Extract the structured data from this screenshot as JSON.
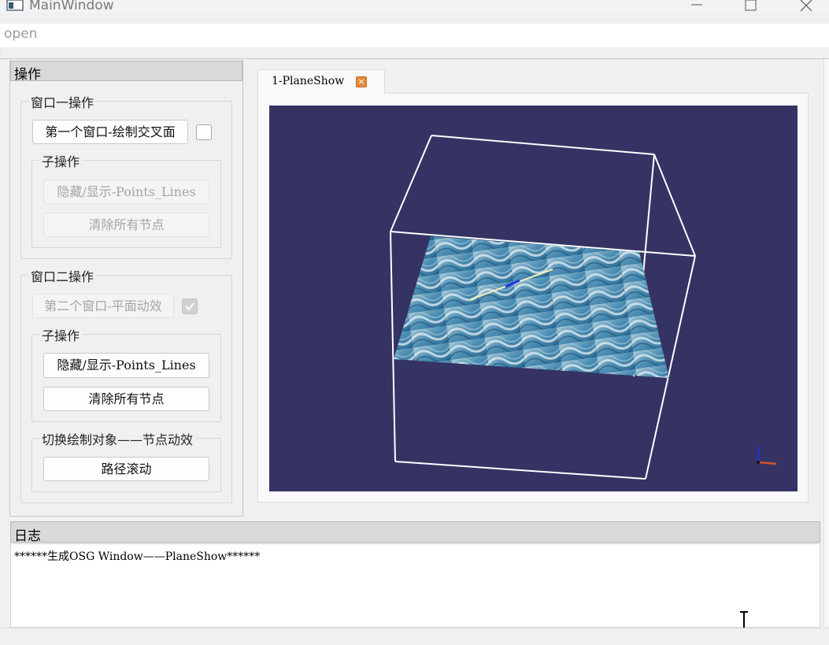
{
  "window": {
    "title": "MainWindow"
  },
  "menu": {
    "open_label": "open"
  },
  "ops_dock": {
    "title": "操作",
    "window1": {
      "group_title": "窗口一操作",
      "primary_button": "第一个窗口-绘制交叉面",
      "primary_checked": false,
      "sub_group_title": "子操作",
      "toggle_button": "隐藏/显示-Points_Lines",
      "clear_button": "清除所有节点",
      "sub_enabled": false
    },
    "window2": {
      "group_title": "窗口二操作",
      "primary_button": "第二个窗口-平面动效",
      "primary_checked": true,
      "sub_group_title": "子操作",
      "toggle_button": "隐藏/显示-Points_Lines",
      "clear_button": "清除所有节点",
      "switch_group_title": "切换绘制对象——节点动效",
      "path_button": "路径滚动"
    }
  },
  "tabs": [
    {
      "label": "1-PlaneShow",
      "active": true
    }
  ],
  "viewport": {
    "background": "#343364",
    "wireframe_color": "#ffffff",
    "plane_texture": "water-waves"
  },
  "log": {
    "title": "日志",
    "lines": [
      "******生成OSG Window——PlaneShow******"
    ]
  },
  "icons": {
    "app": "app-window-icon",
    "minimize": "minimize-icon",
    "maximize": "maximize-icon",
    "close": "close-icon",
    "tab_close": "tab-close-icon",
    "check": "checkmark-icon",
    "axes": "axes-gizmo-icon",
    "cursor": "text-cursor-icon"
  }
}
